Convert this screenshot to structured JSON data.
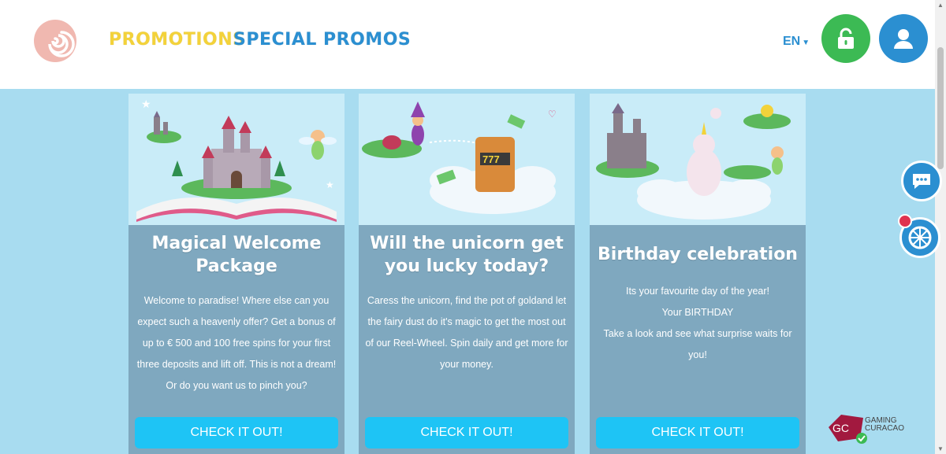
{
  "header": {
    "nav": {
      "promotions": "PROMOTIONS",
      "special_promos": "SPECIAL PROMOS"
    },
    "language": "EN",
    "colors": {
      "promotions": "#f3d23a",
      "special_promos": "#2b8fd1",
      "login": "#3cba54",
      "account": "#2b8fd1"
    }
  },
  "cards": [
    {
      "title": "Magical Welcome Package",
      "description": [
        "Welcome to paradise! Where else can you expect such a heavenly offer? Get a bonus of up to € 500 and 100 free spins for your first three deposits and lift off. This is not a dream! Or do you want us to pinch you?"
      ],
      "cta": "CHECK IT OUT!"
    },
    {
      "title": "Will the unicorn get you lucky today?",
      "description": [
        "Caress the unicorn, find the pot of goldand let the fairy dust do it's magic to get the most out of our Reel-Wheel. Spin daily and get more for your money."
      ],
      "cta": "CHECK IT OUT!"
    },
    {
      "title": "Birthday celebration",
      "description": [
        "Its your favourite day of the year!",
        "Your BIRTHDAY",
        "Take a look and see what surprise waits for you!"
      ],
      "cta": "CHECK IT OUT!"
    }
  ],
  "badge": {
    "line1": "GAMING",
    "line2": "CURACAO",
    "initials": "GC"
  },
  "colors": {
    "background": "#a8dcf0",
    "card": "#7fa8bf",
    "cta": "#1ec4f5"
  }
}
